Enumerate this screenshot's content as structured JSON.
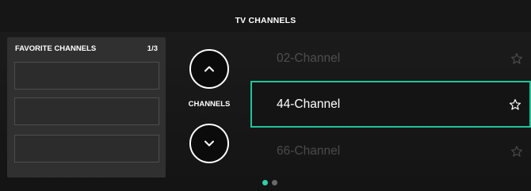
{
  "header": {
    "title": "TV CHANNELS"
  },
  "favorites": {
    "title": "FAVORITE CHANNELS",
    "count": "1/3",
    "slots": [
      "",
      "",
      ""
    ]
  },
  "controls": {
    "label": "CHANNELS",
    "up_icon": "chevron-up-icon",
    "down_icon": "chevron-down-icon"
  },
  "channels": {
    "previous": "02-Channel",
    "current": "44-Channel",
    "next": "66-Channel",
    "favorite_icon": "star-outline-icon"
  },
  "pagination": {
    "total_pages": 2,
    "active_page": 1
  },
  "colors": {
    "accent": "#1fc49a",
    "background": "#141414",
    "panel": "#303030"
  }
}
